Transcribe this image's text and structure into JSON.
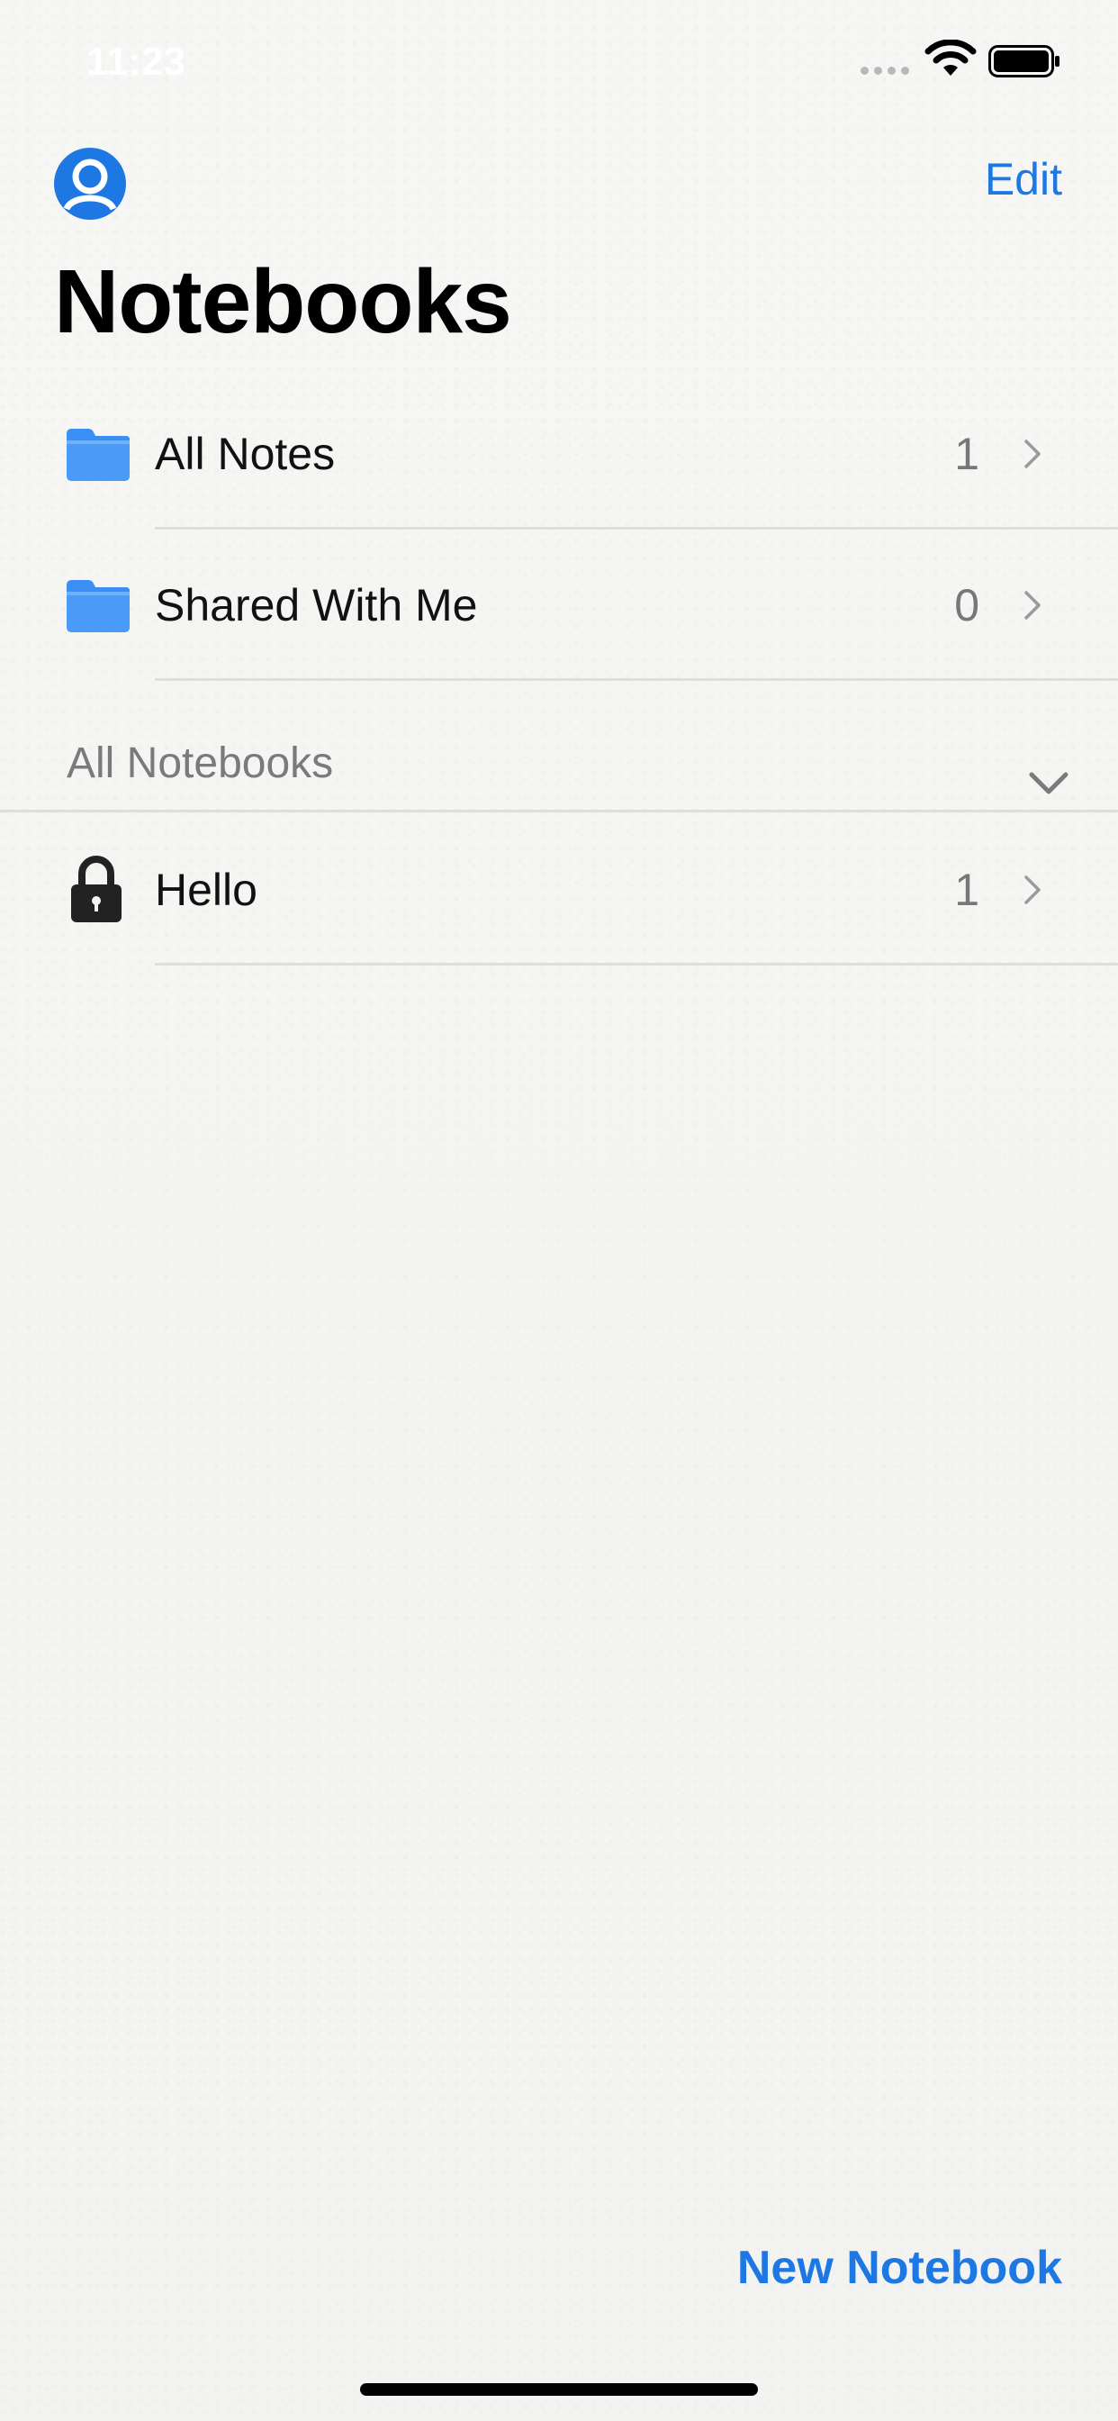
{
  "status_bar": {
    "time": "11:23"
  },
  "header": {
    "edit_label": "Edit",
    "title": "Notebooks"
  },
  "rows": [
    {
      "label": "All Notes",
      "count": "1",
      "icon": "folder-icon"
    },
    {
      "label": "Shared With Me",
      "count": "0",
      "icon": "folder-icon"
    }
  ],
  "section": {
    "label": "All Notebooks",
    "expanded": true
  },
  "notebooks": [
    {
      "label": "Hello",
      "count": "1",
      "icon": "lock-icon"
    }
  ],
  "footer": {
    "new_notebook_label": "New Notebook"
  },
  "colors": {
    "accent": "#1d78e4",
    "folder": "#3b8ef3",
    "background": "#f4f4f2"
  }
}
